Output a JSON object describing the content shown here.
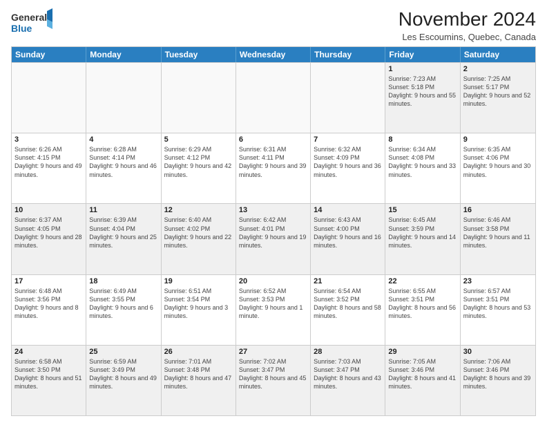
{
  "logo": {
    "line1": "General",
    "line2": "Blue"
  },
  "title": "November 2024",
  "location": "Les Escoumins, Quebec, Canada",
  "days_of_week": [
    "Sunday",
    "Monday",
    "Tuesday",
    "Wednesday",
    "Thursday",
    "Friday",
    "Saturday"
  ],
  "rows": [
    [
      {
        "day": "",
        "empty": true
      },
      {
        "day": "",
        "empty": true
      },
      {
        "day": "",
        "empty": true
      },
      {
        "day": "",
        "empty": true
      },
      {
        "day": "",
        "empty": true
      },
      {
        "day": "1",
        "sunrise": "Sunrise: 7:23 AM",
        "sunset": "Sunset: 5:18 PM",
        "daylight": "Daylight: 9 hours and 55 minutes."
      },
      {
        "day": "2",
        "sunrise": "Sunrise: 7:25 AM",
        "sunset": "Sunset: 5:17 PM",
        "daylight": "Daylight: 9 hours and 52 minutes."
      }
    ],
    [
      {
        "day": "3",
        "sunrise": "Sunrise: 6:26 AM",
        "sunset": "Sunset: 4:15 PM",
        "daylight": "Daylight: 9 hours and 49 minutes."
      },
      {
        "day": "4",
        "sunrise": "Sunrise: 6:28 AM",
        "sunset": "Sunset: 4:14 PM",
        "daylight": "Daylight: 9 hours and 46 minutes."
      },
      {
        "day": "5",
        "sunrise": "Sunrise: 6:29 AM",
        "sunset": "Sunset: 4:12 PM",
        "daylight": "Daylight: 9 hours and 42 minutes."
      },
      {
        "day": "6",
        "sunrise": "Sunrise: 6:31 AM",
        "sunset": "Sunset: 4:11 PM",
        "daylight": "Daylight: 9 hours and 39 minutes."
      },
      {
        "day": "7",
        "sunrise": "Sunrise: 6:32 AM",
        "sunset": "Sunset: 4:09 PM",
        "daylight": "Daylight: 9 hours and 36 minutes."
      },
      {
        "day": "8",
        "sunrise": "Sunrise: 6:34 AM",
        "sunset": "Sunset: 4:08 PM",
        "daylight": "Daylight: 9 hours and 33 minutes."
      },
      {
        "day": "9",
        "sunrise": "Sunrise: 6:35 AM",
        "sunset": "Sunset: 4:06 PM",
        "daylight": "Daylight: 9 hours and 30 minutes."
      }
    ],
    [
      {
        "day": "10",
        "sunrise": "Sunrise: 6:37 AM",
        "sunset": "Sunset: 4:05 PM",
        "daylight": "Daylight: 9 hours and 28 minutes."
      },
      {
        "day": "11",
        "sunrise": "Sunrise: 6:39 AM",
        "sunset": "Sunset: 4:04 PM",
        "daylight": "Daylight: 9 hours and 25 minutes."
      },
      {
        "day": "12",
        "sunrise": "Sunrise: 6:40 AM",
        "sunset": "Sunset: 4:02 PM",
        "daylight": "Daylight: 9 hours and 22 minutes."
      },
      {
        "day": "13",
        "sunrise": "Sunrise: 6:42 AM",
        "sunset": "Sunset: 4:01 PM",
        "daylight": "Daylight: 9 hours and 19 minutes."
      },
      {
        "day": "14",
        "sunrise": "Sunrise: 6:43 AM",
        "sunset": "Sunset: 4:00 PM",
        "daylight": "Daylight: 9 hours and 16 minutes."
      },
      {
        "day": "15",
        "sunrise": "Sunrise: 6:45 AM",
        "sunset": "Sunset: 3:59 PM",
        "daylight": "Daylight: 9 hours and 14 minutes."
      },
      {
        "day": "16",
        "sunrise": "Sunrise: 6:46 AM",
        "sunset": "Sunset: 3:58 PM",
        "daylight": "Daylight: 9 hours and 11 minutes."
      }
    ],
    [
      {
        "day": "17",
        "sunrise": "Sunrise: 6:48 AM",
        "sunset": "Sunset: 3:56 PM",
        "daylight": "Daylight: 9 hours and 8 minutes."
      },
      {
        "day": "18",
        "sunrise": "Sunrise: 6:49 AM",
        "sunset": "Sunset: 3:55 PM",
        "daylight": "Daylight: 9 hours and 6 minutes."
      },
      {
        "day": "19",
        "sunrise": "Sunrise: 6:51 AM",
        "sunset": "Sunset: 3:54 PM",
        "daylight": "Daylight: 9 hours and 3 minutes."
      },
      {
        "day": "20",
        "sunrise": "Sunrise: 6:52 AM",
        "sunset": "Sunset: 3:53 PM",
        "daylight": "Daylight: 9 hours and 1 minute."
      },
      {
        "day": "21",
        "sunrise": "Sunrise: 6:54 AM",
        "sunset": "Sunset: 3:52 PM",
        "daylight": "Daylight: 8 hours and 58 minutes."
      },
      {
        "day": "22",
        "sunrise": "Sunrise: 6:55 AM",
        "sunset": "Sunset: 3:51 PM",
        "daylight": "Daylight: 8 hours and 56 minutes."
      },
      {
        "day": "23",
        "sunrise": "Sunrise: 6:57 AM",
        "sunset": "Sunset: 3:51 PM",
        "daylight": "Daylight: 8 hours and 53 minutes."
      }
    ],
    [
      {
        "day": "24",
        "sunrise": "Sunrise: 6:58 AM",
        "sunset": "Sunset: 3:50 PM",
        "daylight": "Daylight: 8 hours and 51 minutes."
      },
      {
        "day": "25",
        "sunrise": "Sunrise: 6:59 AM",
        "sunset": "Sunset: 3:49 PM",
        "daylight": "Daylight: 8 hours and 49 minutes."
      },
      {
        "day": "26",
        "sunrise": "Sunrise: 7:01 AM",
        "sunset": "Sunset: 3:48 PM",
        "daylight": "Daylight: 8 hours and 47 minutes."
      },
      {
        "day": "27",
        "sunrise": "Sunrise: 7:02 AM",
        "sunset": "Sunset: 3:47 PM",
        "daylight": "Daylight: 8 hours and 45 minutes."
      },
      {
        "day": "28",
        "sunrise": "Sunrise: 7:03 AM",
        "sunset": "Sunset: 3:47 PM",
        "daylight": "Daylight: 8 hours and 43 minutes."
      },
      {
        "day": "29",
        "sunrise": "Sunrise: 7:05 AM",
        "sunset": "Sunset: 3:46 PM",
        "daylight": "Daylight: 8 hours and 41 minutes."
      },
      {
        "day": "30",
        "sunrise": "Sunrise: 7:06 AM",
        "sunset": "Sunset: 3:46 PM",
        "daylight": "Daylight: 8 hours and 39 minutes."
      }
    ]
  ]
}
